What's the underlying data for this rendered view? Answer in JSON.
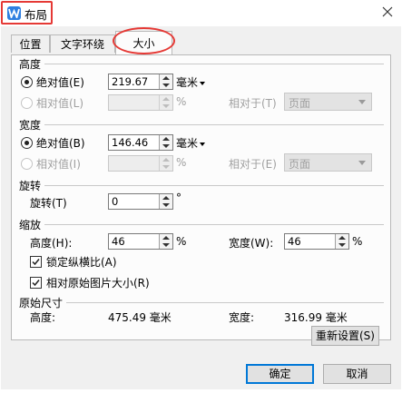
{
  "window": {
    "title": "布局",
    "close_glyph": "✕"
  },
  "tabs": [
    {
      "label": "位置"
    },
    {
      "label": "文字环绕"
    },
    {
      "label": "大小"
    }
  ],
  "height": {
    "title": "高度",
    "absolute": {
      "label": "绝对值(E)",
      "value": "219.67",
      "unit": "毫米"
    },
    "relative": {
      "label": "相对值(L)",
      "value": "",
      "unit": "%"
    },
    "relative_to": {
      "label": "相对于(T)",
      "value": "页面"
    }
  },
  "width": {
    "title": "宽度",
    "absolute": {
      "label": "绝对值(B)",
      "value": "146.46",
      "unit": "毫米"
    },
    "relative": {
      "label": "相对值(I)",
      "value": "",
      "unit": "%"
    },
    "relative_to": {
      "label": "相对于(E)",
      "value": "页面"
    }
  },
  "rotate": {
    "title": "旋转",
    "label": "旋转(T)",
    "value": "0",
    "unit": "°"
  },
  "scale": {
    "title": "缩放",
    "height": {
      "label": "高度(H):",
      "value": "46",
      "unit": "%"
    },
    "width": {
      "label": "宽度(W):",
      "value": "46",
      "unit": "%"
    },
    "lock_ratio": {
      "label": "锁定纵横比(A)",
      "checked": true
    },
    "relative_original": {
      "label": "相对原始图片大小(R)",
      "checked": true
    }
  },
  "original": {
    "title": "原始尺寸",
    "height_label": "高度:",
    "height_value": "475.49 毫米",
    "width_label": "宽度:",
    "width_value": "316.99 毫米",
    "reset_label": "重新设置(S)"
  },
  "footer": {
    "ok_label": "确定",
    "cancel_label": "取消"
  },
  "colors": {
    "accent": "#0078d7",
    "highlight_red": "#e53935",
    "app_blue": "#2f7fe0"
  }
}
